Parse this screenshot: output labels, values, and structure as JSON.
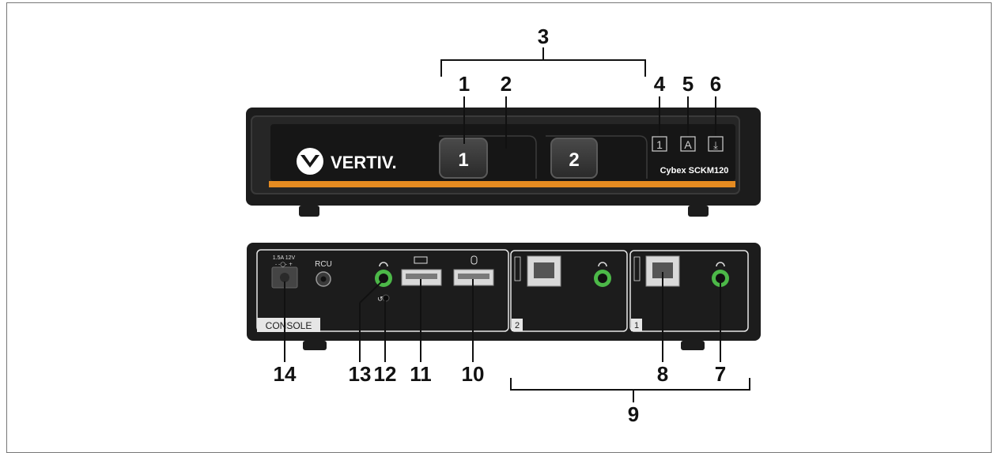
{
  "front": {
    "brand": "VERTIV.",
    "model": "Cybex SCKM120",
    "button_1": "1",
    "button_2": "2",
    "indicator_channel": "1",
    "indicator_audio": "A",
    "indicator_download": "⤓"
  },
  "rear": {
    "power_rating_1": "1.5A 12V",
    "power_rating_2": "- -◯- +",
    "rcu_label": "RCU",
    "console_label": "CONSOLE",
    "port_2_label": "2",
    "port_1_label": "1"
  },
  "callouts": {
    "c1": "1",
    "c2": "2",
    "c3": "3",
    "c4": "4",
    "c5": "5",
    "c6": "6",
    "c7": "7",
    "c8": "8",
    "c9": "9",
    "c10": "10",
    "c11": "11",
    "c12": "12",
    "c13": "13",
    "c14": "14"
  },
  "colors": {
    "accent_orange": "#e58b21",
    "audio_green": "#4cb848",
    "chassis": "#1c1c1c"
  }
}
